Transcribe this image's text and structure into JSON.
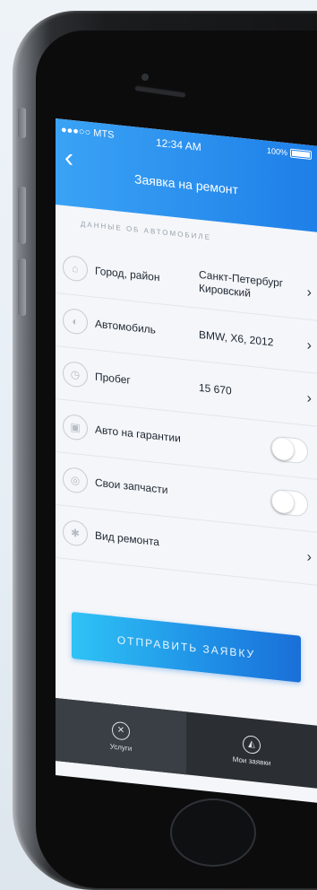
{
  "status_bar": {
    "carrier": "●●●○○ MTS",
    "time": "12:34 AM",
    "battery": "100%"
  },
  "header": {
    "back_icon": "‹",
    "title": "Заявка на ремонт"
  },
  "section_label": "ДАННЫЕ ОБ АВТОМОБИЛЕ",
  "rows": [
    {
      "label": "Город, район",
      "value": "Санкт-Петербург\nКировский",
      "icon": "⌂",
      "chevron": "›"
    },
    {
      "label": "Автомобиль",
      "value": "BMW, X6, 2012",
      "icon": "◐",
      "chevron": "›"
    },
    {
      "label": "Пробег",
      "value": "15 670",
      "icon": "◷",
      "chevron": "›"
    },
    {
      "label": "Авто на гарантии",
      "icon": "▣"
    },
    {
      "label": "Свои запчасти",
      "icon": "◎"
    },
    {
      "label": "Вид ремонта",
      "icon": "✱",
      "chevron": "›"
    }
  ],
  "submit_label": "ОТПРАВИТЬ ЗАЯВКУ",
  "tabs": [
    {
      "label": "Услуги",
      "icon": "✕"
    },
    {
      "label": "Мои заявки",
      "icon": "◭"
    }
  ]
}
